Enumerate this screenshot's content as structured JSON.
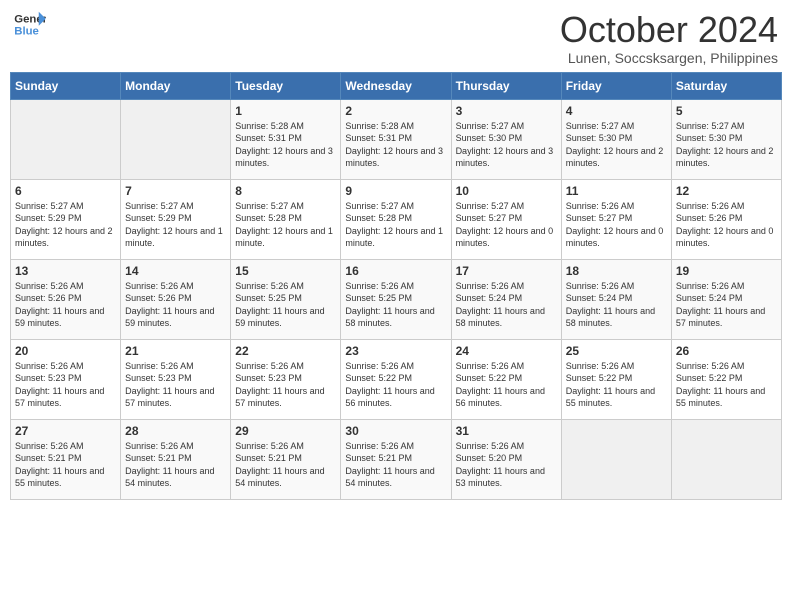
{
  "logo": {
    "line1": "General",
    "line2": "Blue"
  },
  "title": "October 2024",
  "subtitle": "Lunen, Soccsksargen, Philippines",
  "days_of_week": [
    "Sunday",
    "Monday",
    "Tuesday",
    "Wednesday",
    "Thursday",
    "Friday",
    "Saturday"
  ],
  "weeks": [
    [
      {
        "day": "",
        "content": ""
      },
      {
        "day": "",
        "content": ""
      },
      {
        "day": "1",
        "content": "Sunrise: 5:28 AM\nSunset: 5:31 PM\nDaylight: 12 hours and 3 minutes."
      },
      {
        "day": "2",
        "content": "Sunrise: 5:28 AM\nSunset: 5:31 PM\nDaylight: 12 hours and 3 minutes."
      },
      {
        "day": "3",
        "content": "Sunrise: 5:27 AM\nSunset: 5:30 PM\nDaylight: 12 hours and 3 minutes."
      },
      {
        "day": "4",
        "content": "Sunrise: 5:27 AM\nSunset: 5:30 PM\nDaylight: 12 hours and 2 minutes."
      },
      {
        "day": "5",
        "content": "Sunrise: 5:27 AM\nSunset: 5:30 PM\nDaylight: 12 hours and 2 minutes."
      }
    ],
    [
      {
        "day": "6",
        "content": "Sunrise: 5:27 AM\nSunset: 5:29 PM\nDaylight: 12 hours and 2 minutes."
      },
      {
        "day": "7",
        "content": "Sunrise: 5:27 AM\nSunset: 5:29 PM\nDaylight: 12 hours and 1 minute."
      },
      {
        "day": "8",
        "content": "Sunrise: 5:27 AM\nSunset: 5:28 PM\nDaylight: 12 hours and 1 minute."
      },
      {
        "day": "9",
        "content": "Sunrise: 5:27 AM\nSunset: 5:28 PM\nDaylight: 12 hours and 1 minute."
      },
      {
        "day": "10",
        "content": "Sunrise: 5:27 AM\nSunset: 5:27 PM\nDaylight: 12 hours and 0 minutes."
      },
      {
        "day": "11",
        "content": "Sunrise: 5:26 AM\nSunset: 5:27 PM\nDaylight: 12 hours and 0 minutes."
      },
      {
        "day": "12",
        "content": "Sunrise: 5:26 AM\nSunset: 5:26 PM\nDaylight: 12 hours and 0 minutes."
      }
    ],
    [
      {
        "day": "13",
        "content": "Sunrise: 5:26 AM\nSunset: 5:26 PM\nDaylight: 11 hours and 59 minutes."
      },
      {
        "day": "14",
        "content": "Sunrise: 5:26 AM\nSunset: 5:26 PM\nDaylight: 11 hours and 59 minutes."
      },
      {
        "day": "15",
        "content": "Sunrise: 5:26 AM\nSunset: 5:25 PM\nDaylight: 11 hours and 59 minutes."
      },
      {
        "day": "16",
        "content": "Sunrise: 5:26 AM\nSunset: 5:25 PM\nDaylight: 11 hours and 58 minutes."
      },
      {
        "day": "17",
        "content": "Sunrise: 5:26 AM\nSunset: 5:24 PM\nDaylight: 11 hours and 58 minutes."
      },
      {
        "day": "18",
        "content": "Sunrise: 5:26 AM\nSunset: 5:24 PM\nDaylight: 11 hours and 58 minutes."
      },
      {
        "day": "19",
        "content": "Sunrise: 5:26 AM\nSunset: 5:24 PM\nDaylight: 11 hours and 57 minutes."
      }
    ],
    [
      {
        "day": "20",
        "content": "Sunrise: 5:26 AM\nSunset: 5:23 PM\nDaylight: 11 hours and 57 minutes."
      },
      {
        "day": "21",
        "content": "Sunrise: 5:26 AM\nSunset: 5:23 PM\nDaylight: 11 hours and 57 minutes."
      },
      {
        "day": "22",
        "content": "Sunrise: 5:26 AM\nSunset: 5:23 PM\nDaylight: 11 hours and 57 minutes."
      },
      {
        "day": "23",
        "content": "Sunrise: 5:26 AM\nSunset: 5:22 PM\nDaylight: 11 hours and 56 minutes."
      },
      {
        "day": "24",
        "content": "Sunrise: 5:26 AM\nSunset: 5:22 PM\nDaylight: 11 hours and 56 minutes."
      },
      {
        "day": "25",
        "content": "Sunrise: 5:26 AM\nSunset: 5:22 PM\nDaylight: 11 hours and 55 minutes."
      },
      {
        "day": "26",
        "content": "Sunrise: 5:26 AM\nSunset: 5:22 PM\nDaylight: 11 hours and 55 minutes."
      }
    ],
    [
      {
        "day": "27",
        "content": "Sunrise: 5:26 AM\nSunset: 5:21 PM\nDaylight: 11 hours and 55 minutes."
      },
      {
        "day": "28",
        "content": "Sunrise: 5:26 AM\nSunset: 5:21 PM\nDaylight: 11 hours and 54 minutes."
      },
      {
        "day": "29",
        "content": "Sunrise: 5:26 AM\nSunset: 5:21 PM\nDaylight: 11 hours and 54 minutes."
      },
      {
        "day": "30",
        "content": "Sunrise: 5:26 AM\nSunset: 5:21 PM\nDaylight: 11 hours and 54 minutes."
      },
      {
        "day": "31",
        "content": "Sunrise: 5:26 AM\nSunset: 5:20 PM\nDaylight: 11 hours and 53 minutes."
      },
      {
        "day": "",
        "content": ""
      },
      {
        "day": "",
        "content": ""
      }
    ]
  ]
}
